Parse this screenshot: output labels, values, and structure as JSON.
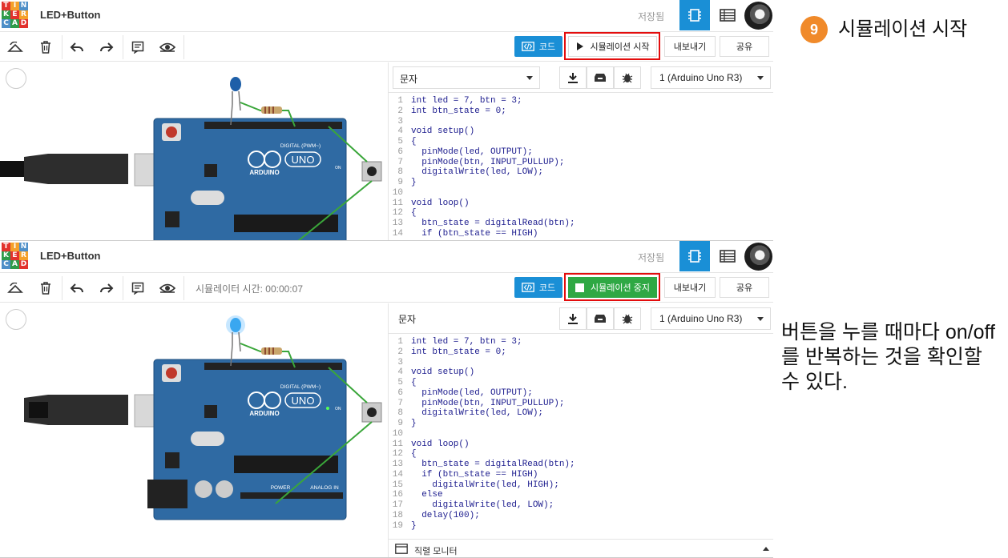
{
  "app": {
    "logo_letters": [
      "T",
      "I",
      "N",
      "K",
      "E",
      "R",
      "C",
      "A",
      "D"
    ],
    "project_title": "LED+Button",
    "saved_label": "저장됨"
  },
  "toolbar": {
    "code_label": "코드",
    "export_label": "내보내기",
    "share_label": "공유",
    "sim_start_label": "시뮬레이션 시작",
    "sim_stop_label": "시뮬레이션 중지",
    "sim_time_label": "시뮬레이터 시간: 00:00:07"
  },
  "code_panel": {
    "mode": "문자",
    "device": "1 (Arduino Uno R3)",
    "serial_monitor": "직렬 모니터",
    "lines_top": [
      {
        "n": "1",
        "t": "int led = 7, btn = 3;"
      },
      {
        "n": "2",
        "t": "int btn_state = 0;"
      },
      {
        "n": "3",
        "t": ""
      },
      {
        "n": "4",
        "t": "void setup()"
      },
      {
        "n": "5",
        "t": "{"
      },
      {
        "n": "6",
        "t": "  pinMode(led, OUTPUT);"
      },
      {
        "n": "7",
        "t": "  pinMode(btn, INPUT_PULLUP);"
      },
      {
        "n": "8",
        "t": "  digitalWrite(led, LOW);"
      },
      {
        "n": "9",
        "t": "}"
      },
      {
        "n": "10",
        "t": ""
      },
      {
        "n": "11",
        "t": "void loop()"
      },
      {
        "n": "12",
        "t": "{"
      },
      {
        "n": "13",
        "t": "  btn_state = digitalRead(btn);"
      },
      {
        "n": "14",
        "t": "  if (btn_state == HIGH)"
      }
    ],
    "lines_bottom": [
      {
        "n": "1",
        "t": "int led = 7, btn = 3;"
      },
      {
        "n": "2",
        "t": "int btn_state = 0;"
      },
      {
        "n": "3",
        "t": ""
      },
      {
        "n": "4",
        "t": "void setup()"
      },
      {
        "n": "5",
        "t": "{"
      },
      {
        "n": "6",
        "t": "  pinMode(led, OUTPUT);"
      },
      {
        "n": "7",
        "t": "  pinMode(btn, INPUT_PULLUP);"
      },
      {
        "n": "8",
        "t": "  digitalWrite(led, LOW);"
      },
      {
        "n": "9",
        "t": "}"
      },
      {
        "n": "10",
        "t": ""
      },
      {
        "n": "11",
        "t": "void loop()"
      },
      {
        "n": "12",
        "t": "{"
      },
      {
        "n": "13",
        "t": "  btn_state = digitalRead(btn);"
      },
      {
        "n": "14",
        "t": "  if (btn_state == HIGH)"
      },
      {
        "n": "15",
        "t": "    digitalWrite(led, HIGH);"
      },
      {
        "n": "16",
        "t": "  else"
      },
      {
        "n": "17",
        "t": "    digitalWrite(led, LOW);"
      },
      {
        "n": "18",
        "t": "  delay(100);"
      },
      {
        "n": "19",
        "t": "}"
      }
    ]
  },
  "board": {
    "digital_label": "DIGITAL (PWM~)",
    "brand": "ARDUINO",
    "model": "UNO",
    "power_label": "POWER",
    "analog_label": "ANALOG IN",
    "on_label": "ON"
  },
  "annotations": {
    "step_number": "9",
    "step_title": "시뮬레이션 시작",
    "note": "버튼을 누를 때마다 on/off를 반복하는 것을 확인할 수 있다."
  },
  "colors": {
    "accent": "#1a8fd6",
    "stop_green": "#2fa844",
    "highlight_red": "#e30d0d",
    "step_orange": "#f08a2a",
    "board_blue": "#2f6aa3"
  }
}
